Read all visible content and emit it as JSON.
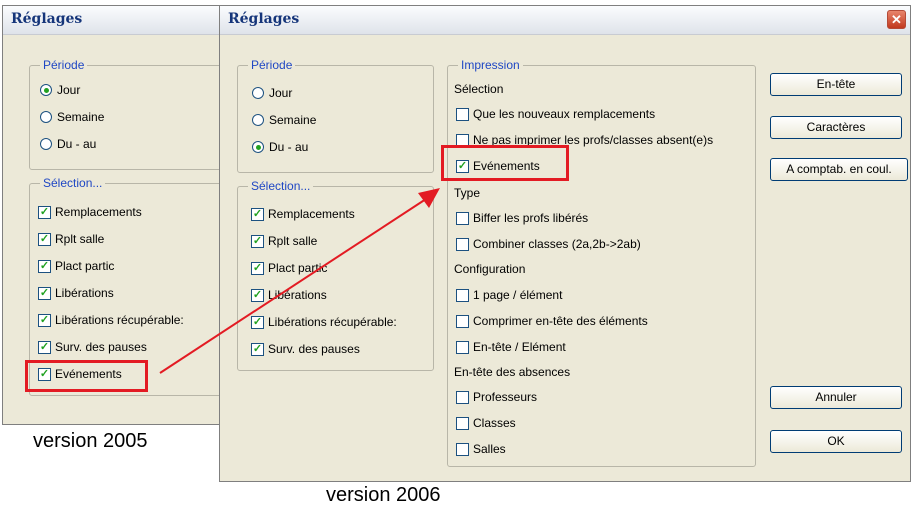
{
  "win2005": {
    "title": "Réglages",
    "periode": {
      "legend": "Période",
      "options": [
        "Jour",
        "Semaine",
        "Du - au"
      ]
    },
    "selection": {
      "legend": "Sélection...",
      "items": [
        "Remplacements",
        "Rplt salle",
        "Plact partic",
        "Libérations",
        "Libérations récupérable:",
        "Surv. des pauses",
        "Evénements"
      ]
    }
  },
  "win2006": {
    "title": "Réglages",
    "close": "✕",
    "periode": {
      "legend": "Période",
      "options": [
        "Jour",
        "Semaine",
        "Du - au"
      ]
    },
    "selection": {
      "legend": "Sélection...",
      "items": [
        "Remplacements",
        "Rplt salle",
        "Plact partic",
        "Libérations",
        "Libérations récupérable:",
        "Surv. des pauses"
      ]
    },
    "impression": {
      "legend": "Impression",
      "selection_label": "Sélection",
      "selection_items": [
        "Que les nouveaux remplacements",
        "Ne pas imprimer les profs/classes absent(e)s",
        "Evénements"
      ],
      "type_label": "Type",
      "type_items": [
        "Biffer les profs libérés",
        "Combiner classes (2a,2b->2ab)"
      ],
      "config_label": "Configuration",
      "config_items": [
        "1 page / élément",
        "Comprimer en-tête des éléments",
        "En-tête / Elément"
      ],
      "absences_label": "En-tête des absences",
      "absences_items": [
        "Professeurs",
        "Classes",
        "Salles"
      ]
    },
    "buttons": {
      "entete": "En-tête",
      "caracteres": "Caractères",
      "acomptab": "A comptab. en coul.",
      "annuler": "Annuler",
      "ok": "OK"
    }
  },
  "captions": {
    "v2005": "version 2005",
    "v2006": "version 2006"
  },
  "checkmark": "✓",
  "colors": {
    "highlight": "#e31b23",
    "legend": "#1f47c4",
    "check": "#21a121"
  }
}
